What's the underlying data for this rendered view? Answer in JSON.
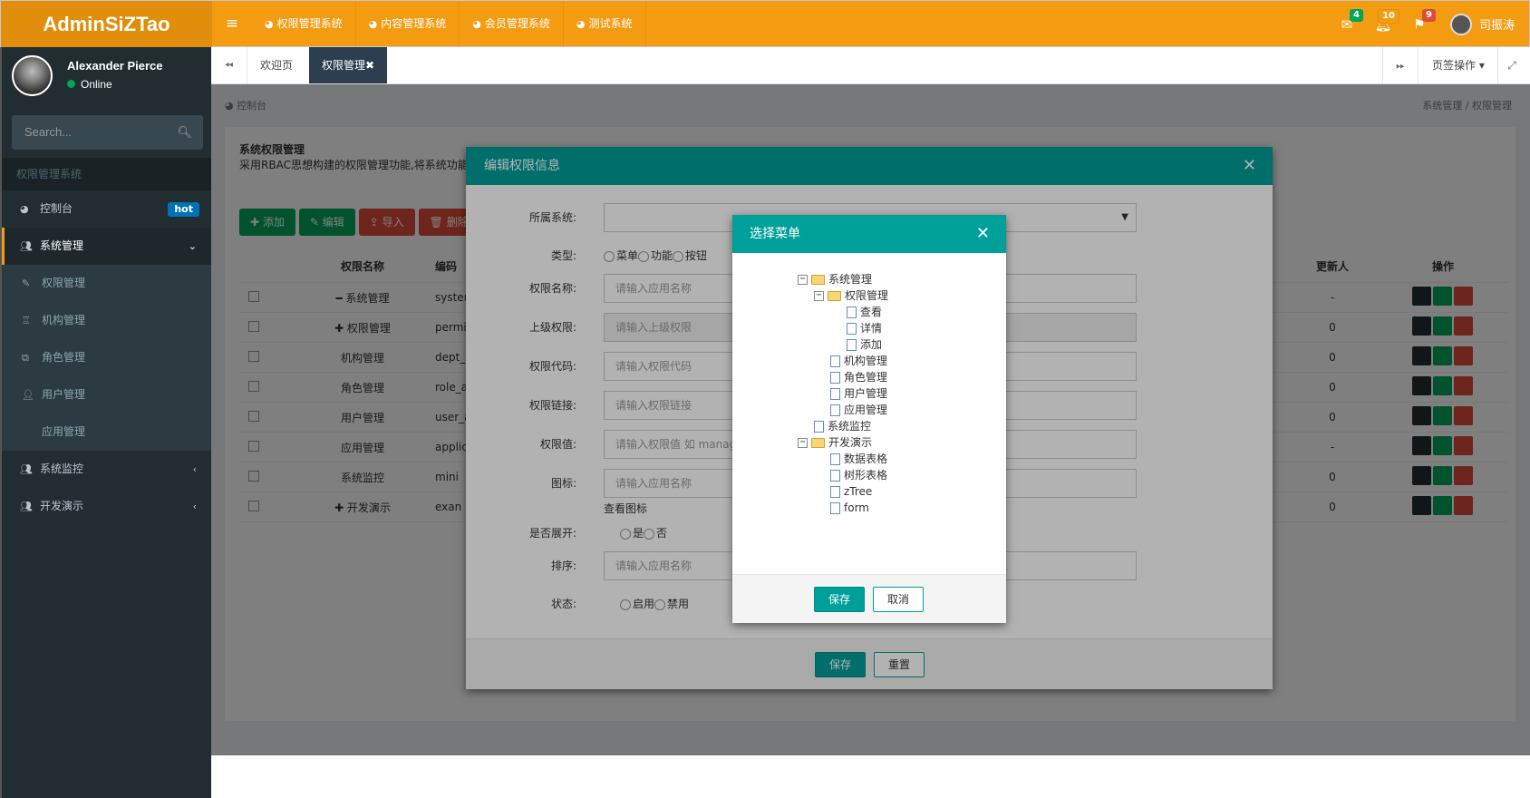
{
  "app": {
    "logo": "AdminSiZTao"
  },
  "topnav": {
    "items": [
      {
        "label": "权限管理系统"
      },
      {
        "label": "内容管理系统"
      },
      {
        "label": "会员管理系统"
      },
      {
        "label": "测试系统"
      }
    ]
  },
  "header_right": {
    "mail_count": "4",
    "bell_count": "10",
    "flag_count": "9",
    "user": "司振涛"
  },
  "sidebar": {
    "user_name": "Alexander Pierce",
    "status": "Online",
    "search_placeholder": "Search...",
    "section_title": "权限管理系统",
    "dashboard": "控制台",
    "hot_badge": "hot",
    "system_mgmt": "系统管理",
    "sub": [
      "权限管理",
      "机构管理",
      "角色管理",
      "用户管理",
      "应用管理"
    ],
    "monitor": "系统监控",
    "demo": "开发演示"
  },
  "tabs": {
    "items": [
      "欢迎页",
      "权限管理"
    ],
    "page_ops": "页签操作"
  },
  "breadcrumb": {
    "left": "控制台",
    "right1": "系统管理",
    "right2": "权限管理"
  },
  "box": {
    "title": "系统权限管理",
    "desc": "采用RBAC思想构建的权限管理功能,将系统功能"
  },
  "toolbar": {
    "add": "添加",
    "edit": "编辑",
    "import": "导入",
    "delete": "删除"
  },
  "grid": {
    "headers": {
      "name": "权限名称",
      "code": "编码",
      "updater": "更新人",
      "ops": "操作"
    },
    "rows": [
      {
        "name": "━ 系统管理",
        "code": "system_m",
        "updater": "-"
      },
      {
        "name": "✚ 权限管理",
        "code": "permission",
        "updater": "0"
      },
      {
        "name": "机构管理",
        "code": "dept_a",
        "updater": "0"
      },
      {
        "name": "角色管理",
        "code": "role_a",
        "updater": "0"
      },
      {
        "name": "用户管理",
        "code": "user_ad",
        "updater": "0"
      },
      {
        "name": "应用管理",
        "code": "applica",
        "updater": "-"
      },
      {
        "name": "系统监控",
        "code": "mini",
        "updater": "0"
      },
      {
        "name": "✚ 开发演示",
        "code": "exan",
        "updater": "0"
      }
    ]
  },
  "edit_modal": {
    "title": "编辑权限信息",
    "labels": {
      "system": "所属系统:",
      "type": "类型:",
      "name": "权限名称:",
      "parent": "上级权限:",
      "code": "权限代码:",
      "link": "权限链接:",
      "value": "权限值:",
      "icon": "图标:",
      "expand": "是否展开:",
      "sort": "排序:",
      "status": "状态:"
    },
    "type_options": [
      "菜单",
      "功能",
      "按钮"
    ],
    "placeholders": {
      "name": "请输入应用名称",
      "parent": "请输入上级权限",
      "code": "请输入权限代码",
      "link": "请输入权限链接",
      "value": "请输入权限值 如 manage",
      "icon": "请输入应用名称",
      "sort": "请输入应用名称"
    },
    "view_icon": "查看图标",
    "expand_options": [
      "是",
      "否"
    ],
    "status_options": [
      "启用",
      "禁用"
    ],
    "save": "保存",
    "reset": "重置"
  },
  "menu_modal": {
    "title": "选择菜单",
    "tree": {
      "root1": "系统管理",
      "perm": "权限管理",
      "leaf1": "查看",
      "leaf2": "详情",
      "leaf3": "添加",
      "org": "机构管理",
      "role": "角色管理",
      "user": "用户管理",
      "app": "应用管理",
      "monitor": "系统监控",
      "root2": "开发演示",
      "d1": "数据表格",
      "d2": "树形表格",
      "d3": "zTree",
      "d4": "form"
    },
    "save": "保存",
    "cancel": "取消"
  }
}
